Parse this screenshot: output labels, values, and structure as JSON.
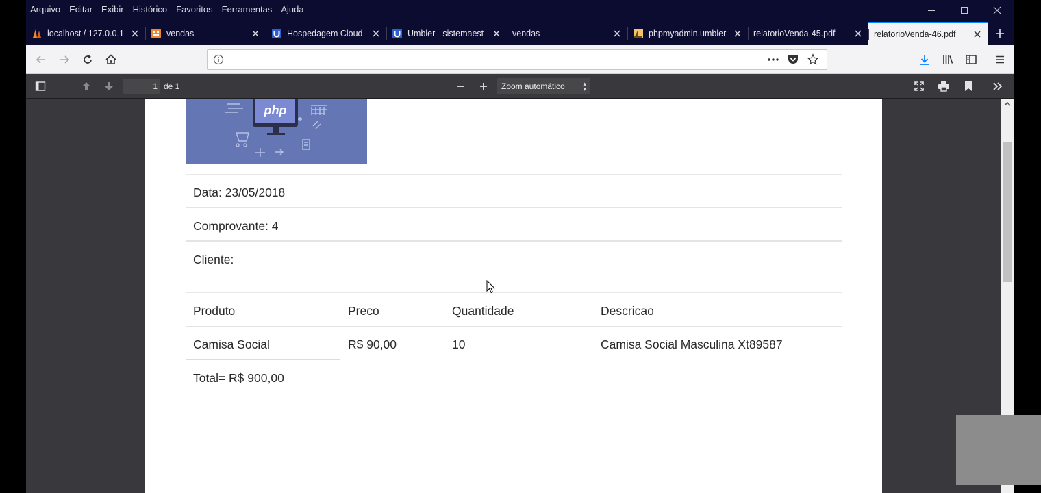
{
  "menu": [
    "Arquivo",
    "Editar",
    "Exibir",
    "Histórico",
    "Favoritos",
    "Ferramentas",
    "Ajuda"
  ],
  "tabs": [
    {
      "title": "localhost / 127.0.0.1",
      "icon": "phpmyadmin-sail-icon",
      "width": 174
    },
    {
      "title": "vendas",
      "icon": "orange-grid-icon",
      "width": 176
    },
    {
      "title": "Hospedagem Cloud",
      "icon": "umbler-icon",
      "width": 176
    },
    {
      "title": "Umbler - sistemaest",
      "icon": "umbler-icon",
      "width": 176
    },
    {
      "title": "vendas",
      "icon": "",
      "width": 176
    },
    {
      "title": "phpmyadmin.umbler",
      "icon": "phpmyadmin-icon",
      "width": 176
    },
    {
      "title": "relatorioVenda-45.pdf",
      "icon": "",
      "width": 176
    },
    {
      "title": "relatorioVenda-46.pdf",
      "icon": "",
      "width": 174,
      "active": true
    }
  ],
  "urlbar": {
    "value": ""
  },
  "pdf_toolbar": {
    "page_current": "1",
    "page_of": "de 1",
    "zoom": "Zoom automático"
  },
  "document": {
    "logo_text": "php",
    "data_line": "Data: 23/05/2018",
    "comprovante_line": "Comprovante: 4",
    "cliente_line": "Cliente:",
    "table": {
      "headers": [
        "Produto",
        "Preco",
        "Quantidade",
        "Descricao"
      ],
      "rows": [
        [
          "Camisa Social",
          "R$ 90,00",
          "10",
          "Camisa Social Masculina Xt89587"
        ]
      ]
    },
    "total_line": "Total= R$ 900,00"
  },
  "colors": {
    "titlebar": "#0c0c30",
    "toolbar": "#f3f3f5",
    "pdf_toolbar": "#38383d",
    "accent": "#0a84ff",
    "logo_bg": "#6476b4"
  }
}
